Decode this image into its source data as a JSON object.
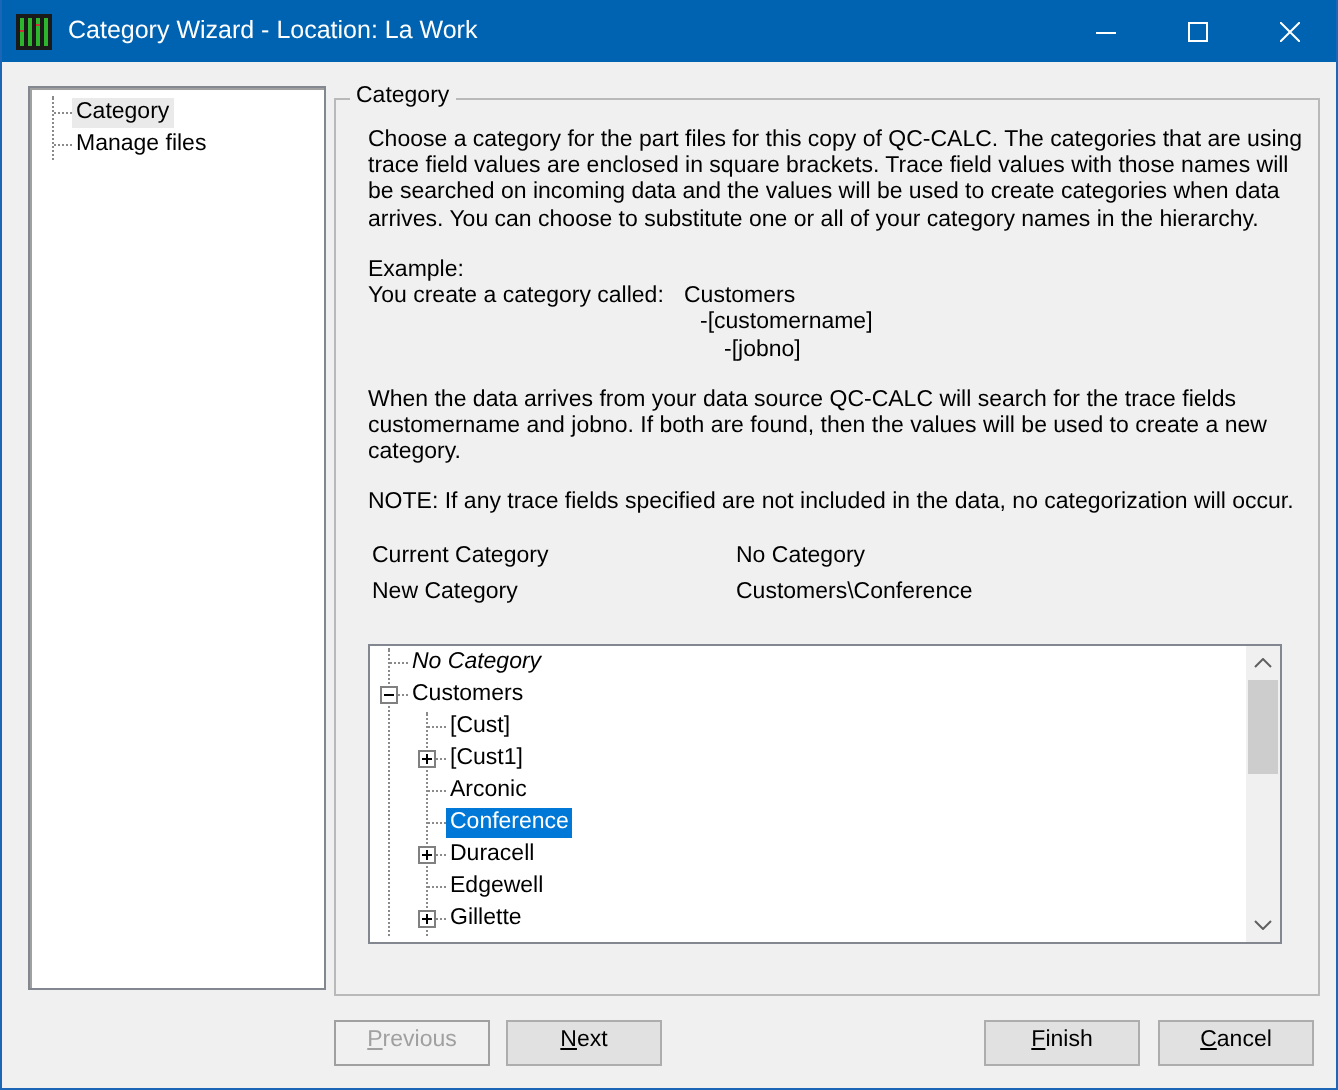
{
  "window": {
    "title": "Category Wizard - Location: La Work"
  },
  "steps": [
    {
      "label": "Category",
      "selected": true
    },
    {
      "label": "Manage files",
      "selected": false
    }
  ],
  "group": {
    "legend": "Category",
    "intro": "Choose a category for the part files for this copy of QC-CALC. The categories that are using trace field values are enclosed in square brackets. Trace field values with those names will be searched on incoming data and the values will be used to create categories when data arrives. You can choose to substitute one or all of your category names in the hierarchy.",
    "example": {
      "heading": "Example:",
      "label": "You create a category called:",
      "hierarchy": [
        {
          "text": "Customers",
          "children": [
            {
              "text": "-[customername]",
              "children": [
                {
                  "text": "-[jobno]"
                }
              ]
            }
          ]
        }
      ]
    },
    "explanation": "When the data arrives from your data source QC-CALC will search for the trace fields customername and jobno. If both are found, then the values will be used to create a new category.",
    "note": "NOTE: If any trace fields specified are not included in the data, no categorization will occur.",
    "info": [
      {
        "label": "Current Category",
        "value": "No Category"
      },
      {
        "label": "New Category",
        "value": "Customers\\Conference"
      }
    ],
    "tree": [
      {
        "label": "No Category",
        "italic": true,
        "selected": false
      },
      {
        "label": "Customers",
        "selected": false,
        "expanded": true,
        "children": [
          {
            "label": "[Cust]",
            "selected": false
          },
          {
            "label": "[Cust1]",
            "selected": false,
            "expanded": false
          },
          {
            "label": "Arconic",
            "selected": false
          },
          {
            "label": "Conference",
            "selected": true
          },
          {
            "label": "Duracell",
            "selected": false,
            "expanded": false
          },
          {
            "label": "Edgewell",
            "selected": false
          },
          {
            "label": "Gillette",
            "selected": false,
            "expanded": false
          }
        ]
      }
    ]
  },
  "buttons": {
    "left": [
      {
        "label": "Previous",
        "disabled": true,
        "underline_first": true
      },
      {
        "label": "Next",
        "disabled": false,
        "underline_first": true
      }
    ],
    "right": [
      {
        "label": "Finish",
        "disabled": false,
        "underline_first": true
      },
      {
        "label": "Cancel",
        "disabled": false,
        "underline_first": true
      }
    ]
  }
}
